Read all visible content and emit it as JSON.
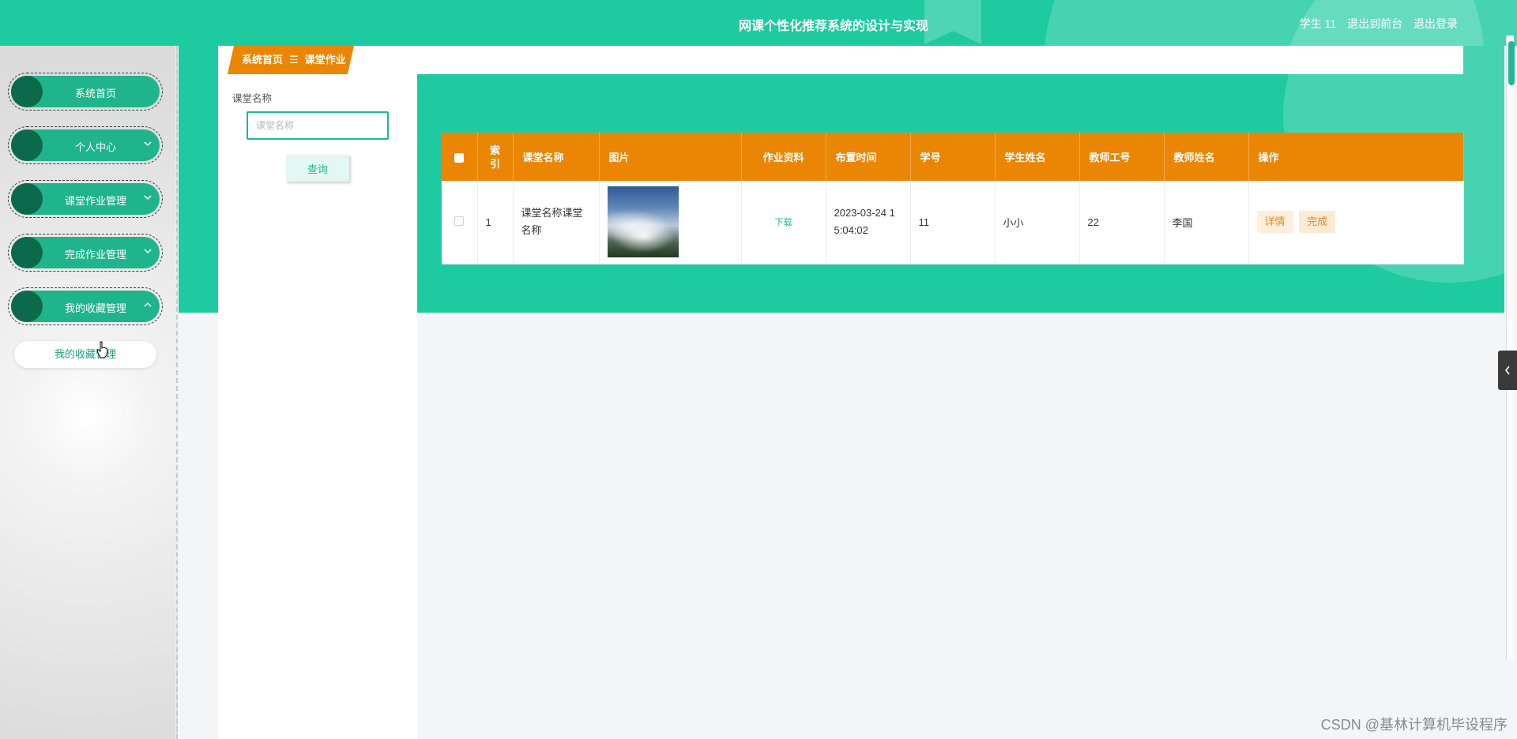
{
  "header": {
    "title": "网课个性化推荐系统的设计与实现",
    "user": "学生 11",
    "to_front": "退出到前台",
    "logout": "退出登录"
  },
  "sidebar": {
    "items": [
      {
        "label": "系统首页",
        "chevron": "none"
      },
      {
        "label": "个人中心",
        "chevron": "down"
      },
      {
        "label": "课堂作业管理",
        "chevron": "down"
      },
      {
        "label": "完成作业管理",
        "chevron": "down"
      },
      {
        "label": "我的收藏管理",
        "chevron": "up"
      }
    ],
    "sub_item": "我的收藏管理"
  },
  "breadcrumb": {
    "home": "系统首页",
    "separator": "☰",
    "current": "课堂作业"
  },
  "search": {
    "label": "课堂名称",
    "placeholder": "课堂名称",
    "button": "查询"
  },
  "table": {
    "headers": [
      "索引",
      "课堂名称",
      "图片",
      "作业资料",
      "布置时间",
      "学号",
      "学生姓名",
      "教师工号",
      "教师姓名",
      "操作"
    ],
    "index_header": "索\n引",
    "rows": [
      {
        "index": "1",
        "course": "课堂名称课堂名称",
        "material": "下载",
        "time": "2023-03-24 15:04:02",
        "student_no": "11",
        "student_name": "小小",
        "teacher_no": "22",
        "teacher_name": "李国",
        "ops": [
          "详情",
          "完成"
        ]
      }
    ]
  },
  "colors": {
    "primary_green": "#1ecaa0",
    "menu_green": "#20b48c",
    "table_header_orange": "#ea8604"
  },
  "watermark": "CSDN @基林计算机毕设程序"
}
